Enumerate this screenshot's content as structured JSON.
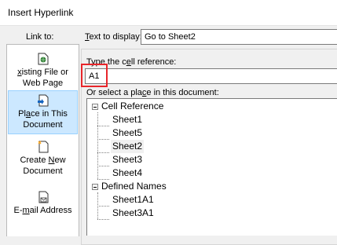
{
  "window": {
    "title": "Insert Hyperlink"
  },
  "link_to": {
    "label": "Link to:",
    "items": [
      {
        "pre": "",
        "ul": "x",
        "post": "isting File or",
        "line2": "Web Page",
        "icon": "existing-file-icon"
      },
      {
        "pre": "Pl",
        "ul": "a",
        "post": "ce in This",
        "line2": "Document",
        "icon": "place-in-document-icon"
      },
      {
        "line1": "Create ",
        "ul": "N",
        "post": "ew",
        "line2": "Document",
        "icon": "new-document-icon"
      },
      {
        "pre": "E-",
        "ul": "m",
        "post": "ail Address",
        "icon": "email-icon"
      }
    ]
  },
  "text_to_display": {
    "ul": "T",
    "rest": "ext to display:",
    "value": "Go to Sheet2"
  },
  "cell_reference": {
    "pre": "Type the c",
    "ul": "e",
    "post": "ll reference:",
    "value": "A1"
  },
  "place": {
    "pre": "Or select a pla",
    "ul": "c",
    "post": "e in this document:"
  },
  "tree": {
    "cell_ref_group": "Cell Reference",
    "sheets": [
      "Sheet1",
      "Sheet5",
      "Sheet2",
      "Sheet3",
      "Sheet4"
    ],
    "selected": "Sheet2",
    "defined_names_group": "Defined Names",
    "names": [
      "Sheet1A1",
      "Sheet3A1"
    ]
  },
  "colors": {
    "selection": "#cce8ff",
    "highlight_box": "#e8262b"
  }
}
